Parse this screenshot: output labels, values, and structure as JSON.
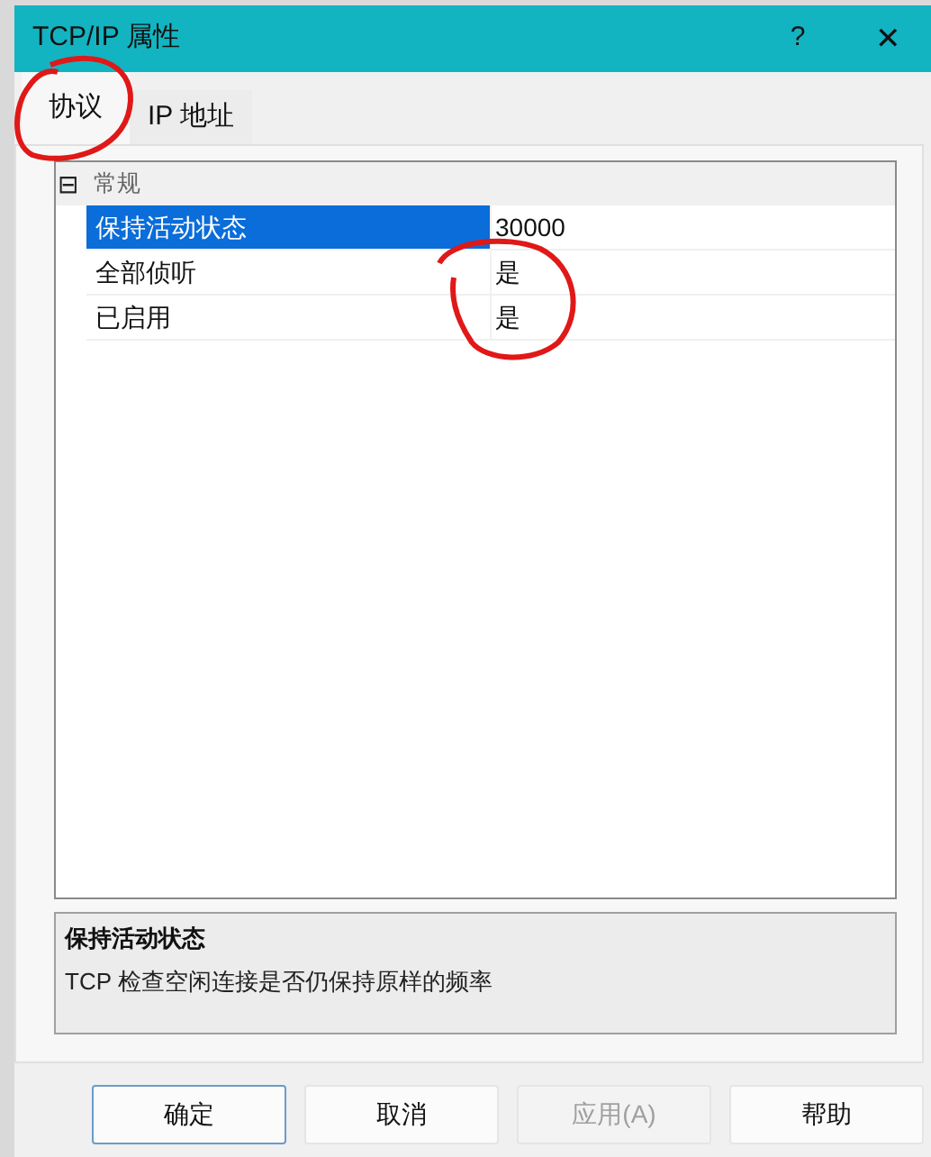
{
  "window": {
    "title": "TCP/IP 属性",
    "help_glyph": "?",
    "close_glyph": "✕"
  },
  "tabs": [
    {
      "label": "协议",
      "selected": true
    },
    {
      "label": "IP 地址",
      "selected": false
    }
  ],
  "property_grid": {
    "group": {
      "label": "常规",
      "expanded": true,
      "glyph": "⊟"
    },
    "rows": [
      {
        "name": "保持活动状态",
        "value": "30000",
        "selected": true
      },
      {
        "name": "全部侦听",
        "value": "是",
        "selected": false
      },
      {
        "name": "已启用",
        "value": "是",
        "selected": false
      }
    ]
  },
  "description": {
    "title": "保持活动状态",
    "text": "TCP 检查空闲连接是否仍保持原样的频率"
  },
  "buttons": [
    {
      "label": "确定",
      "disabled": false,
      "default": true
    },
    {
      "label": "取消",
      "disabled": false,
      "default": false
    },
    {
      "label": "应用(A)",
      "disabled": true,
      "default": false
    },
    {
      "label": "帮助",
      "disabled": false,
      "default": false
    }
  ]
}
